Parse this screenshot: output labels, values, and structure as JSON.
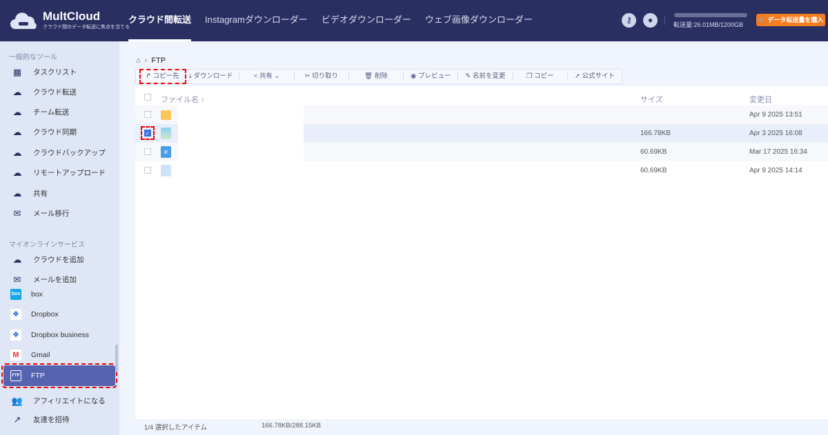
{
  "header": {
    "logo_name": "MultCloud",
    "logo_tagline": "クラウド間のデータ転送に焦点を当てる",
    "nav": [
      "クラウド間転送",
      "Instagramダウンローダー",
      "ビデオダウンローダー",
      "ウェブ画像ダウンローダー"
    ],
    "quota_text": "転送量:26.01MB/1200GB",
    "buy_label": "データ転送量を購入",
    "accent": "#f57c1f"
  },
  "sidebar": {
    "section1": "一般的なツール",
    "tools": [
      "タスクリスト",
      "クラウド転送",
      "チーム転送",
      "クラウド同期",
      "クラウドバックアップ",
      "リモートアップロード",
      "共有",
      "メール移行"
    ],
    "section2": "マイオンラインサービス",
    "services": [
      "クラウドを追加",
      "メールを追加",
      "box",
      "Dropbox",
      "Dropbox business",
      "Gmail",
      "FTP"
    ],
    "extras": [
      "アフィリエイトになる",
      "友達を招待"
    ]
  },
  "breadcrumb": {
    "current": "FTP"
  },
  "toolbar": [
    "コピー先",
    "ダウンロード",
    "共有",
    "切り取り",
    "削除",
    "プレビュー",
    "名前を変更",
    "コピー",
    "公式サイト"
  ],
  "table": {
    "headers": {
      "name": "ファイル名",
      "size": "サイズ",
      "modified": "変更日"
    },
    "rows": [
      {
        "type": "folder",
        "size": "",
        "date": "Apr 9 2025 13:51"
      },
      {
        "type": "image",
        "size": "166.78KB",
        "date": "Apr 3 2025 16:08"
      },
      {
        "type": "web",
        "size": "60.69KB",
        "date": "Mar 17 2025 16:34"
      },
      {
        "type": "file",
        "size": "60.69KB",
        "date": "Apr 9 2025 14:14"
      }
    ]
  },
  "status": {
    "selected": "1/4 選択したアイテム",
    "size": "166.78KB/288.15KB"
  }
}
